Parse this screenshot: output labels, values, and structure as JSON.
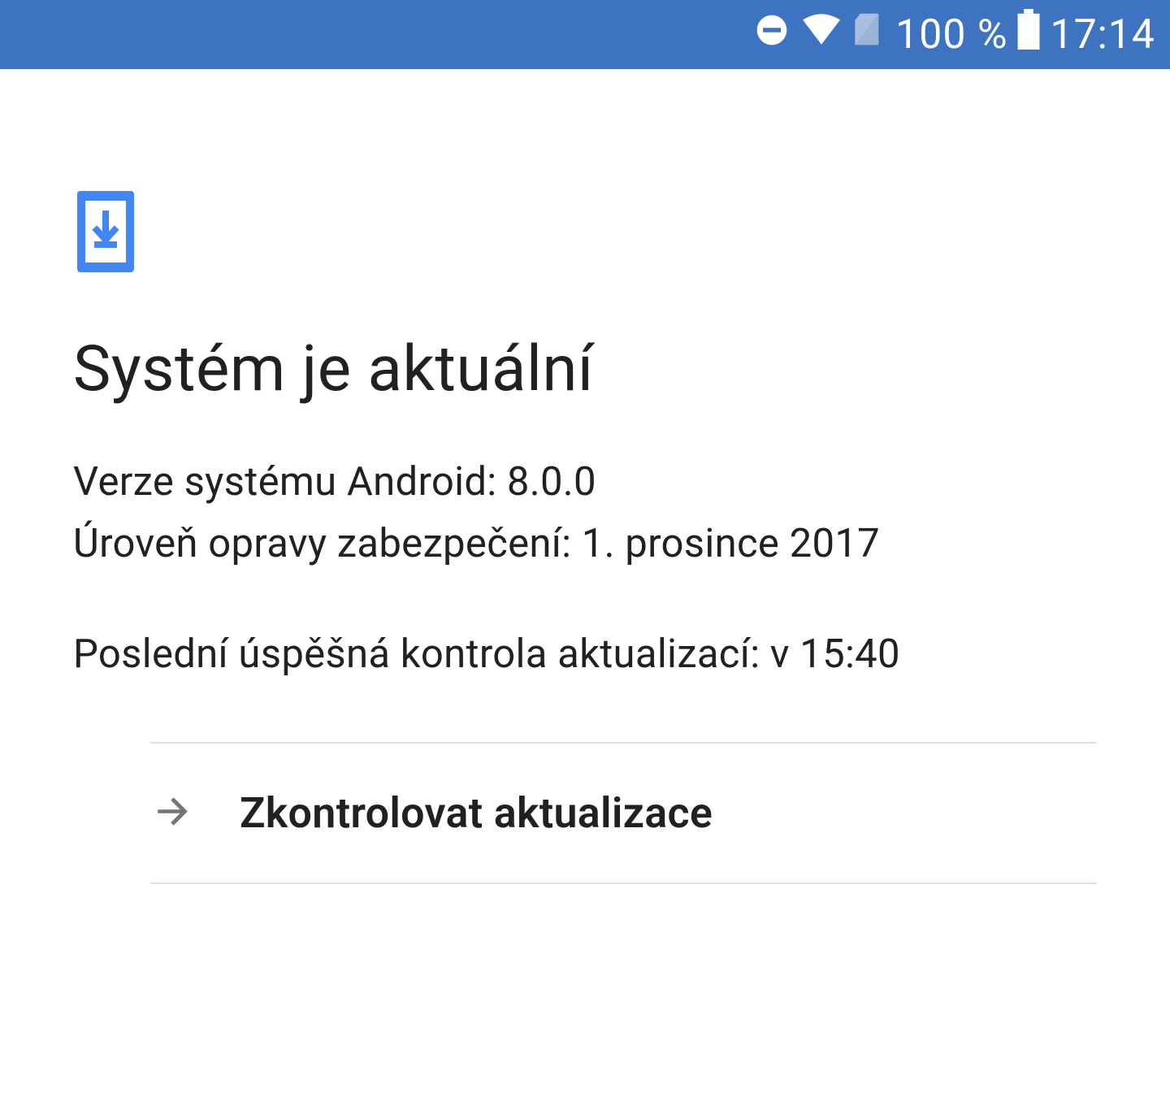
{
  "status_bar": {
    "battery_percent": "100 %",
    "time": "17:14"
  },
  "page": {
    "title": "Systém je aktuální",
    "android_version_line": "Verze systému Android: 8.0.0",
    "security_patch_line": "Úroveň opravy zabezpečení: 1. prosince 2017",
    "last_check_line": "Poslední úspěšná kontrola aktualizací: v 15:40"
  },
  "actions": {
    "check_updates_label": "Zkontrolovat aktualizace"
  },
  "colors": {
    "status_bar_bg": "#3e73c2",
    "accent": "#4285f4",
    "text_primary": "#212121",
    "divider": "#e0e0e0",
    "arrow": "#757575"
  }
}
